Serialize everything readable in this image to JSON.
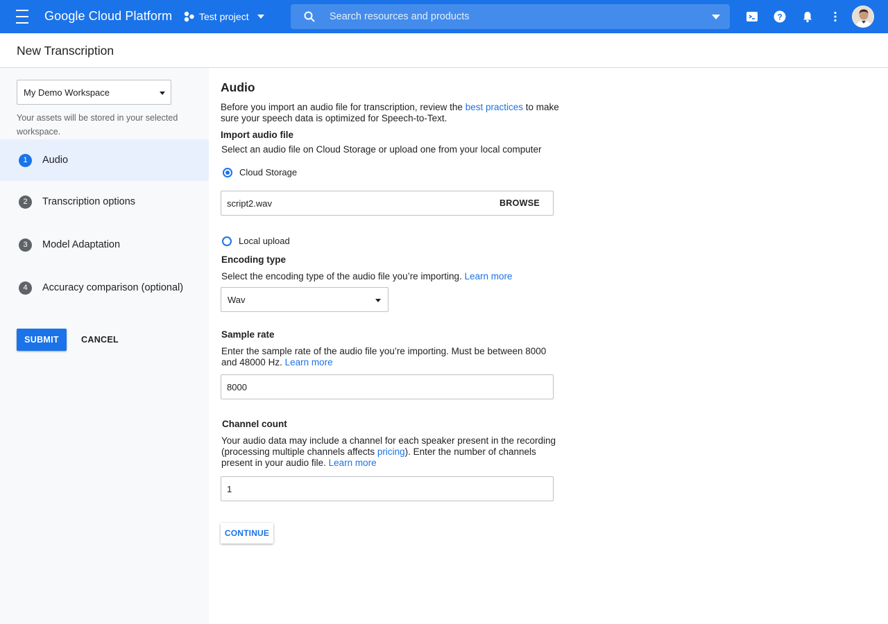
{
  "topbar": {
    "brand": "Google Cloud Platform",
    "project": "Test project",
    "search_placeholder": "Search resources and products",
    "brand_color": "#1a73e8"
  },
  "header": {
    "title": "New Transcription"
  },
  "sidebar": {
    "workspace": "My Demo Workspace",
    "workspace_help": "Your assets will be stored in your selected workspace.",
    "steps": [
      {
        "num": "1",
        "label": "Audio",
        "active": true
      },
      {
        "num": "2",
        "label": "Transcription options",
        "active": false
      },
      {
        "num": "3",
        "label": "Model Adaptation",
        "active": false
      },
      {
        "num": "4",
        "label": "Accuracy comparison (optional)",
        "active": false
      }
    ],
    "submit_label": "SUBMIT",
    "cancel_label": "CANCEL"
  },
  "main": {
    "title": "Audio",
    "intro_pre": "Before you import an audio file for transcription, review the ",
    "intro_link": "best practices",
    "intro_post": " to make sure your speech data is optimized for Speech-to-Text.",
    "import": {
      "heading": "Import audio file",
      "desc": "Select an audio file on Cloud Storage or upload one from your local computer",
      "option_cloud": "Cloud Storage",
      "option_local": "Local upload",
      "selected": "Cloud Storage",
      "file_value": "script2.wav",
      "browse_label": "BROWSE"
    },
    "encoding": {
      "heading": "Encoding type",
      "desc": "Select the encoding type of the audio file you’re importing. ",
      "link": "Learn more",
      "value": "Wav"
    },
    "sample_rate": {
      "heading": "Sample rate",
      "desc": "Enter the sample rate of the audio file you’re importing. Must be between 8000 and 48000 Hz. ",
      "link": "Learn more",
      "value": "8000"
    },
    "channels": {
      "heading": "Channel count",
      "desc_pre": "Your audio data may include a channel for each speaker present in the recording (processing multiple channels affects ",
      "desc_link": "pricing",
      "desc_post": "). Enter the number of channels present in your audio file. ",
      "link": "Learn more",
      "value": "1"
    },
    "continue_label": "CONTINUE"
  }
}
